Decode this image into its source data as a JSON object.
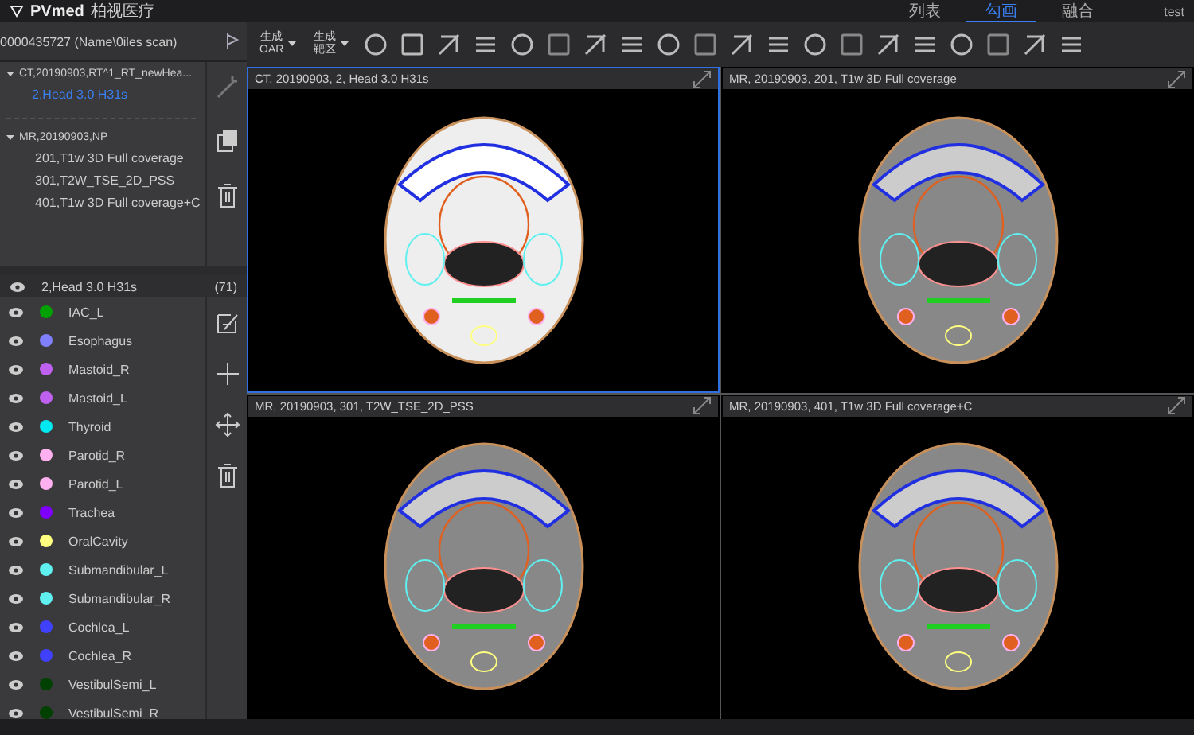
{
  "app": {
    "logo": "PVmed",
    "company": "柏视医疗",
    "user": "test"
  },
  "mode_tabs": [
    {
      "label": "列表",
      "selected": false
    },
    {
      "label": "勾画",
      "selected": true
    },
    {
      "label": "融合",
      "selected": false
    }
  ],
  "toolbar": {
    "generate_buttons": [
      {
        "line1": "生成",
        "line2": "OAR"
      },
      {
        "line1": "生成",
        "line2": "靶区"
      }
    ]
  },
  "patient": {
    "title": "0000435727 (Name\\0iles scan)"
  },
  "series_tree": [
    {
      "label": "CT,20190903,RT^1_RT_newHea...",
      "expanded": true,
      "children": [
        {
          "label": "2,Head 3.0 H31s",
          "selected": true
        }
      ]
    },
    {
      "label": "MR,20190903,NP",
      "expanded": true,
      "children": [
        {
          "label": "201,T1w 3D Full coverage",
          "selected": false
        },
        {
          "label": "301,T2W_TSE_2D_PSS",
          "selected": false
        },
        {
          "label": "401,T1w 3D Full coverage+C",
          "selected": false
        }
      ]
    }
  ],
  "structure_set": {
    "title": "2,Head 3.0 H31s",
    "count": "(71)"
  },
  "structures": [
    {
      "name": "IAC_L",
      "color": "#00a000"
    },
    {
      "name": "Esophagus",
      "color": "#8080ff"
    },
    {
      "name": "Mastoid_R",
      "color": "#c060f0"
    },
    {
      "name": "Mastoid_L",
      "color": "#c060f0"
    },
    {
      "name": "Thyroid",
      "color": "#00e8f0"
    },
    {
      "name": "Parotid_R",
      "color": "#ffb0f0"
    },
    {
      "name": "Parotid_L",
      "color": "#ffb0f0"
    },
    {
      "name": "Trachea",
      "color": "#8000ff"
    },
    {
      "name": "OralCavity",
      "color": "#ffff80"
    },
    {
      "name": "Submandibular_L",
      "color": "#60f0f0"
    },
    {
      "name": "Submandibular_R",
      "color": "#60f0f0"
    },
    {
      "name": "Cochlea_L",
      "color": "#4040ff"
    },
    {
      "name": "Cochlea_R",
      "color": "#4040ff"
    },
    {
      "name": "VestibulSemi_L",
      "color": "#004000"
    },
    {
      "name": "VestibulSemi_R",
      "color": "#004000"
    }
  ],
  "viewports": [
    {
      "title": "CT, 20190903, 2, Head 3.0 H31s",
      "kind": "ct",
      "selected": true
    },
    {
      "title": "MR, 20190903, 201, T1w 3D Full coverage",
      "kind": "mr",
      "selected": false
    },
    {
      "title": "MR, 20190903, 301, T2W_TSE_2D_PSS",
      "kind": "mr",
      "selected": false
    },
    {
      "title": "MR, 20190903, 401, T1w 3D Full coverage+C",
      "kind": "mr",
      "selected": false
    }
  ]
}
